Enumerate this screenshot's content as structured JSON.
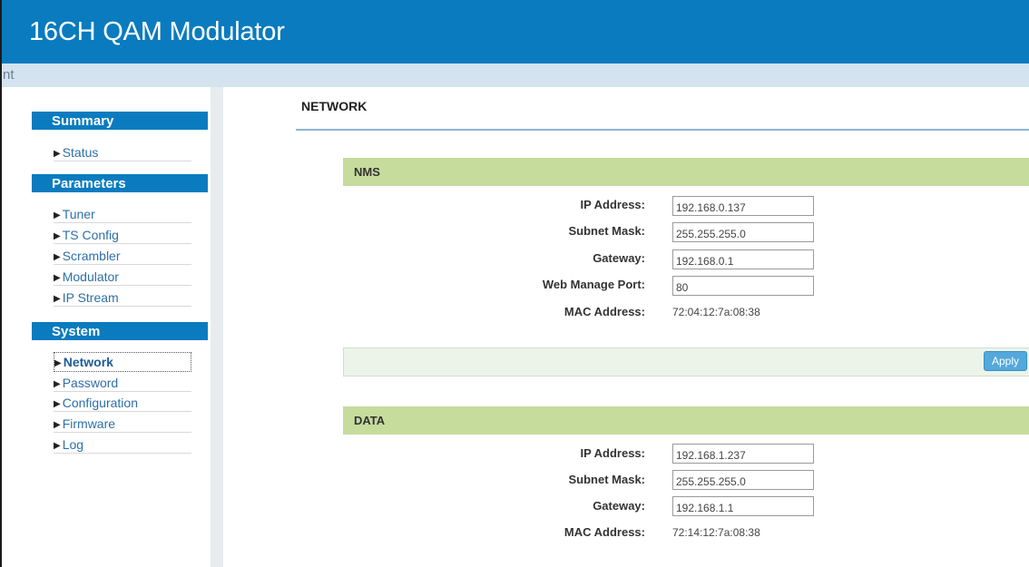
{
  "header": {
    "title": "16CH QAM Modulator"
  },
  "subbar": {
    "text": "nt"
  },
  "sidebar": {
    "sections": [
      {
        "title": "Summary",
        "items": [
          "Status"
        ]
      },
      {
        "title": "Parameters",
        "items": [
          "Tuner",
          "TS Config",
          "Scrambler",
          "Modulator",
          "IP Stream"
        ]
      },
      {
        "title": "System",
        "items": [
          "Network",
          "Password",
          "Configuration",
          "Firmware",
          "Log"
        ]
      }
    ],
    "active_item": "Network"
  },
  "main": {
    "page_title": "NETWORK",
    "nms": {
      "title": "NMS",
      "labels": {
        "ip": "IP Address:",
        "subnet": "Subnet Mask:",
        "gateway": "Gateway:",
        "port": "Web Manage Port:",
        "mac": "MAC Address:"
      },
      "values": {
        "ip": "192.168.0.137",
        "subnet": "255.255.255.0",
        "gateway": "192.168.0.1",
        "port": "80",
        "mac": "72:04:12:7a:08:38"
      }
    },
    "apply_label": "Apply",
    "data": {
      "title": "DATA",
      "labels": {
        "ip": "IP Address:",
        "subnet": "Subnet Mask:",
        "gateway": "Gateway:",
        "mac": "MAC Address:"
      },
      "values": {
        "ip": "192.168.1.237",
        "subnet": "255.255.255.0",
        "gateway": "192.168.1.1",
        "mac": "72:14:12:7a:08:38"
      }
    }
  }
}
